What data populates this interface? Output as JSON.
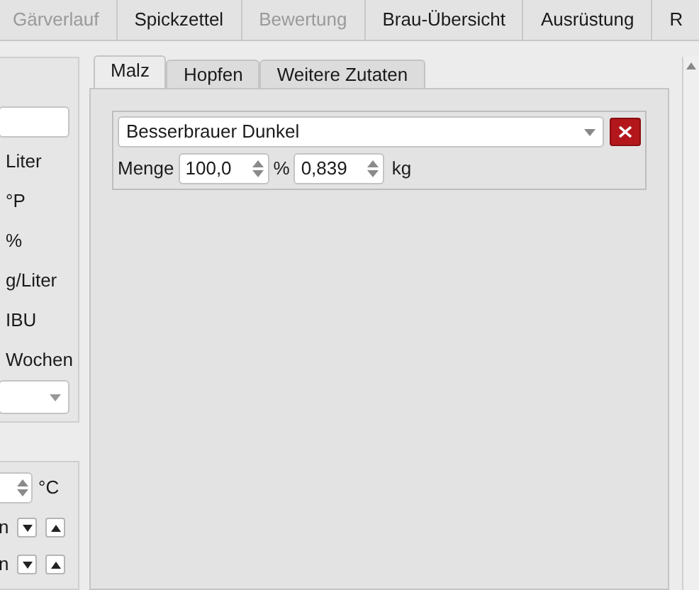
{
  "top_tabs": [
    {
      "label": "Gärverlauf",
      "selected": false,
      "disabled": true
    },
    {
      "label": "Spickzettel",
      "selected": false,
      "disabled": false
    },
    {
      "label": "Bewertung",
      "selected": false,
      "disabled": true
    },
    {
      "label": "Brau-Übersicht",
      "selected": false,
      "disabled": false
    },
    {
      "label": "Ausrüstung",
      "selected": false,
      "disabled": false
    },
    {
      "label": "R",
      "selected": false,
      "disabled": false
    }
  ],
  "left_panel": {
    "units": [
      "Liter",
      "°P",
      "%",
      "g/Liter",
      "IBU",
      "Wochen"
    ]
  },
  "left_panel_2": {
    "temperature_unit": "°C",
    "rows": [
      {
        "label": "n"
      },
      {
        "label": "n"
      }
    ]
  },
  "ingredient_tabs": [
    {
      "label": "Malz",
      "selected": true
    },
    {
      "label": "Hopfen",
      "selected": false
    },
    {
      "label": "Weitere Zutaten",
      "selected": false
    }
  ],
  "malts": [
    {
      "name": "Besserbrauer Dunkel",
      "quantity_label": "Menge",
      "percent": "100,0",
      "percent_unit": "%",
      "weight": "0,839",
      "weight_unit": "kg"
    }
  ]
}
